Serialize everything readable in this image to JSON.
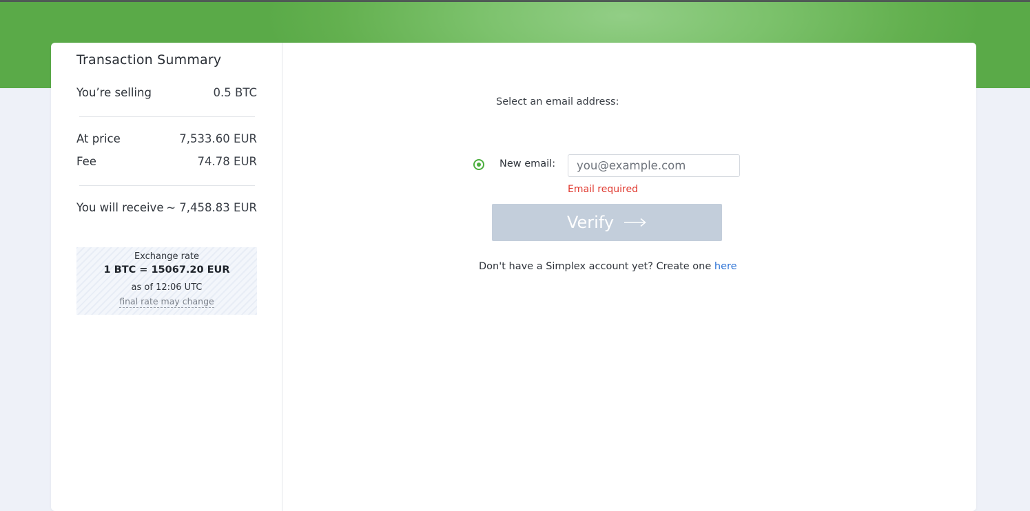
{
  "summary": {
    "title": "Transaction Summary",
    "selling_label": "You’re selling",
    "selling_value": "0.5 BTC",
    "price_label": "At price",
    "price_value": "7,533.60 EUR",
    "fee_label": "Fee",
    "fee_value": "74.78 EUR",
    "receive_label": "You will receive",
    "receive_value": "~ 7,458.83 EUR",
    "rate": {
      "label": "Exchange rate",
      "value": "1 BTC = 15067.20 EUR",
      "time": "as of 12:06 UTC",
      "note": "final rate may change"
    }
  },
  "form": {
    "select_label": "Select an email address:",
    "new_email_label": "New email:",
    "email_placeholder": "you@example.com",
    "email_value": "",
    "error": "Email required",
    "verify_label": "Verify",
    "account_prompt": "Don't have a Simplex account yet? Create one",
    "here_link": "here"
  },
  "colors": {
    "brand_green": "#5aaa48",
    "radio_green": "#4caf3e",
    "error_red": "#e0392f",
    "link_blue": "#2f74d6",
    "button_disabled": "#c3cedb"
  }
}
